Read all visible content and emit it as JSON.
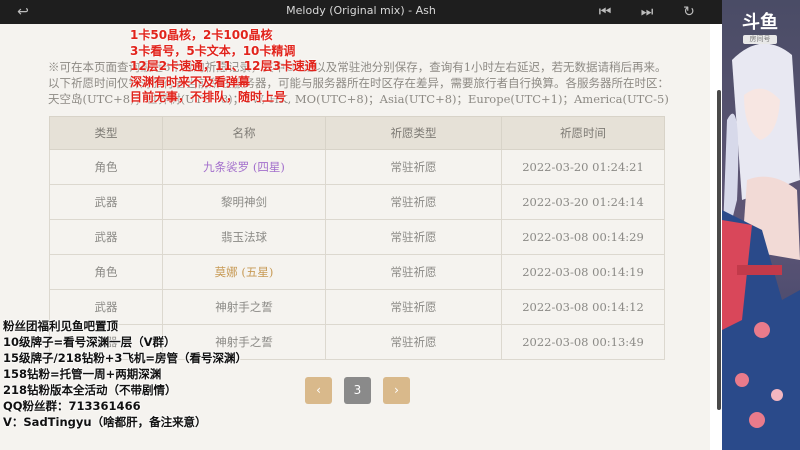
{
  "media": {
    "title": "Melody (Original mix) - Ash"
  },
  "notice": "※可在本页面查询最近6个月的祈愿记录，其中UP池以及常驻池分别保存，查询有1小时左右延迟，若无数据请稍后再来。以下祈愿时间仅针对旅行者当前所在服务器，可能与服务器所在时区存在差异，需要旅行者自行换算。各服务器所在时区：天空岛(UTC+8)；世界树(UTC+8)；TW, HK, MO(UTC+8)；Asia(UTC+8)；Europe(UTC+1)；America(UTC-5)",
  "table": {
    "headers": [
      "类型",
      "名称",
      "祈愿类型",
      "祈愿时间"
    ],
    "rows": [
      {
        "type": "角色",
        "name": "九条裟罗 (四星)",
        "wish": "常驻祈愿",
        "time": "2022-03-20 01:24:21",
        "rarity": "4"
      },
      {
        "type": "武器",
        "name": "黎明神剑",
        "wish": "常驻祈愿",
        "time": "2022-03-20 01:24:14",
        "rarity": "3"
      },
      {
        "type": "武器",
        "name": "翡玉法球",
        "wish": "常驻祈愿",
        "time": "2022-03-08 00:14:29",
        "rarity": "3"
      },
      {
        "type": "角色",
        "name": "莫娜 (五星)",
        "wish": "常驻祈愿",
        "time": "2022-03-08 00:14:19",
        "rarity": "5"
      },
      {
        "type": "武器",
        "name": "神射手之誓",
        "wish": "常驻祈愿",
        "time": "2022-03-08 00:14:12",
        "rarity": "3"
      },
      {
        "type": "武器",
        "name": "神射手之誓",
        "wish": "常驻祈愿",
        "time": "2022-03-08 00:13:49",
        "rarity": "3"
      }
    ]
  },
  "pagination": {
    "prev": "‹",
    "current": "3",
    "next": "›"
  },
  "overlay_red": [
    "1卡50晶核，2卡100晶核",
    "3卡看号，5卡文本，10卡精调",
    "12层2卡速通，11、12层3卡速通",
    "深渊有时来不及看弹幕",
    "目前无事，不排队，随时上号"
  ],
  "overlay_black": [
    "粉丝团福利见鱼吧置顶",
    "10级牌子=看号深渊一层（V群）",
    "15级牌子/218钻粉+3飞机=房管（看号深渊）",
    "158钻粉=托管一周+两期深渊",
    "218钻粉版本全活动（不带剧情）",
    "QQ粉丝群：713361466",
    "V：SadTingyu（啥都肝，备注来意）"
  ],
  "logo": {
    "main": "斗鱼",
    "sub": "房间号"
  },
  "colors": {
    "four_star": "#a36fcc",
    "five_star": "#c79a55",
    "overlay_red": "#e1241c"
  }
}
